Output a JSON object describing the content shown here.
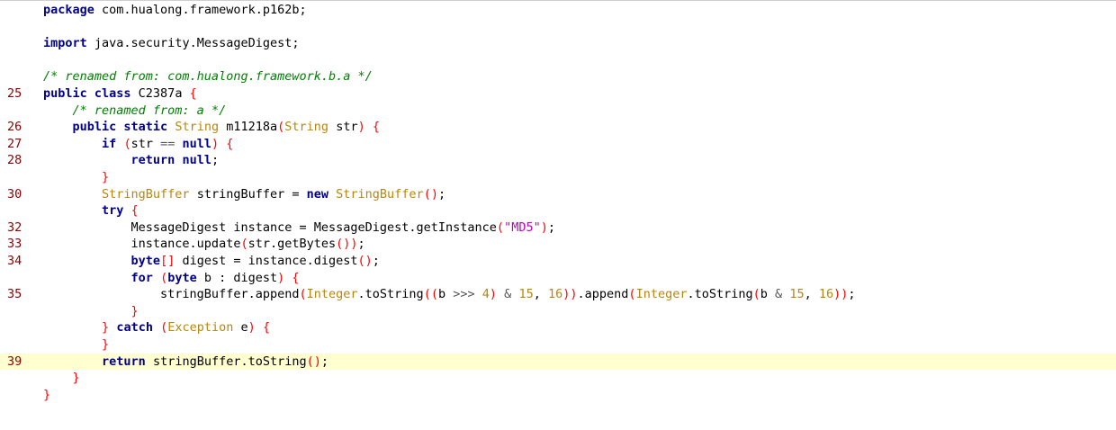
{
  "lines": [
    {
      "ln": "",
      "code": [
        [
          "kw",
          "package"
        ],
        [
          "pl",
          " com.hualong.framework.p162b;"
        ]
      ]
    },
    {
      "ln": "",
      "code": []
    },
    {
      "ln": "",
      "code": [
        [
          "kw",
          "import"
        ],
        [
          "pl",
          " java.security.MessageDigest;"
        ]
      ]
    },
    {
      "ln": "",
      "code": []
    },
    {
      "ln": "",
      "code": [
        [
          "cm",
          "/* renamed from: com.hualong.framework.b.a */"
        ]
      ]
    },
    {
      "ln": "25",
      "code": [
        [
          "kw",
          "public class"
        ],
        [
          "pl",
          " C2387a "
        ],
        [
          "br",
          "{"
        ]
      ]
    },
    {
      "ln": "",
      "code": [
        [
          "pl",
          "    "
        ],
        [
          "cm",
          "/* renamed from: a */"
        ]
      ]
    },
    {
      "ln": "26",
      "code": [
        [
          "pl",
          "    "
        ],
        [
          "kw",
          "public static"
        ],
        [
          "pl",
          " "
        ],
        [
          "ty",
          "String"
        ],
        [
          "pl",
          " m11218a"
        ],
        [
          "br",
          "("
        ],
        [
          "ty",
          "String"
        ],
        [
          "pl",
          " str"
        ],
        [
          "br",
          ")"
        ],
        [
          "pl",
          " "
        ],
        [
          "br",
          "{"
        ]
      ]
    },
    {
      "ln": "27",
      "code": [
        [
          "pl",
          "        "
        ],
        [
          "kw",
          "if"
        ],
        [
          "pl",
          " "
        ],
        [
          "br",
          "("
        ],
        [
          "pl",
          "str "
        ],
        [
          "op",
          "=="
        ],
        [
          "pl",
          " "
        ],
        [
          "kw",
          "null"
        ],
        [
          "br",
          ")"
        ],
        [
          "pl",
          " "
        ],
        [
          "br",
          "{"
        ]
      ]
    },
    {
      "ln": "28",
      "code": [
        [
          "pl",
          "            "
        ],
        [
          "kw",
          "return null"
        ],
        [
          "pl",
          ";"
        ]
      ]
    },
    {
      "ln": "",
      "code": [
        [
          "pl",
          "        "
        ],
        [
          "br",
          "}"
        ]
      ]
    },
    {
      "ln": "30",
      "code": [
        [
          "pl",
          "        "
        ],
        [
          "ty",
          "StringBuffer"
        ],
        [
          "pl",
          " stringBuffer = "
        ],
        [
          "kw",
          "new"
        ],
        [
          "pl",
          " "
        ],
        [
          "ty",
          "StringBuffer"
        ],
        [
          "br",
          "()"
        ],
        [
          "pl",
          ";"
        ]
      ]
    },
    {
      "ln": "",
      "code": [
        [
          "pl",
          "        "
        ],
        [
          "kw",
          "try"
        ],
        [
          "pl",
          " "
        ],
        [
          "br",
          "{"
        ]
      ]
    },
    {
      "ln": "32",
      "code": [
        [
          "pl",
          "            MessageDigest instance = MessageDigest.getInstance"
        ],
        [
          "br",
          "("
        ],
        [
          "st",
          "\"MD5\""
        ],
        [
          "br",
          ")"
        ],
        [
          "pl",
          ";"
        ]
      ]
    },
    {
      "ln": "33",
      "code": [
        [
          "pl",
          "            instance.update"
        ],
        [
          "br",
          "("
        ],
        [
          "pl",
          "str.getBytes"
        ],
        [
          "br",
          "())"
        ],
        [
          "pl",
          ";"
        ]
      ]
    },
    {
      "ln": "34",
      "code": [
        [
          "pl",
          "            "
        ],
        [
          "kw",
          "byte"
        ],
        [
          "br",
          "[]"
        ],
        [
          "pl",
          " digest = instance.digest"
        ],
        [
          "br",
          "()"
        ],
        [
          "pl",
          ";"
        ]
      ]
    },
    {
      "ln": "",
      "code": [
        [
          "pl",
          "            "
        ],
        [
          "kw",
          "for"
        ],
        [
          "pl",
          " "
        ],
        [
          "br",
          "("
        ],
        [
          "kw",
          "byte"
        ],
        [
          "pl",
          " b : digest"
        ],
        [
          "br",
          ")"
        ],
        [
          "pl",
          " "
        ],
        [
          "br",
          "{"
        ]
      ]
    },
    {
      "ln": "35",
      "code": [
        [
          "pl",
          "                stringBuffer.append"
        ],
        [
          "br",
          "("
        ],
        [
          "ty",
          "Integer"
        ],
        [
          "pl",
          ".toString"
        ],
        [
          "br",
          "(("
        ],
        [
          "pl",
          "b "
        ],
        [
          "op",
          ">>>"
        ],
        [
          "pl",
          " "
        ],
        [
          "nm",
          "4"
        ],
        [
          "br",
          ")"
        ],
        [
          "pl",
          " "
        ],
        [
          "op",
          "&"
        ],
        [
          "pl",
          " "
        ],
        [
          "nm",
          "15"
        ],
        [
          "pl",
          ", "
        ],
        [
          "nm",
          "16"
        ],
        [
          "br",
          "))"
        ],
        [
          "pl",
          ".append"
        ],
        [
          "br",
          "("
        ],
        [
          "ty",
          "Integer"
        ],
        [
          "pl",
          ".toString"
        ],
        [
          "br",
          "("
        ],
        [
          "pl",
          "b "
        ],
        [
          "op",
          "&"
        ],
        [
          "pl",
          " "
        ],
        [
          "nm",
          "15"
        ],
        [
          "pl",
          ", "
        ],
        [
          "nm",
          "16"
        ],
        [
          "br",
          "))"
        ],
        [
          "pl",
          ";"
        ]
      ]
    },
    {
      "ln": "",
      "code": [
        [
          "pl",
          "            "
        ],
        [
          "br",
          "}"
        ]
      ]
    },
    {
      "ln": "",
      "code": [
        [
          "pl",
          "        "
        ],
        [
          "br",
          "}"
        ],
        [
          "pl",
          " "
        ],
        [
          "kw",
          "catch"
        ],
        [
          "pl",
          " "
        ],
        [
          "br",
          "("
        ],
        [
          "ty",
          "Exception"
        ],
        [
          "pl",
          " e"
        ],
        [
          "br",
          ")"
        ],
        [
          "pl",
          " "
        ],
        [
          "br",
          "{"
        ]
      ]
    },
    {
      "ln": "",
      "code": [
        [
          "pl",
          "        "
        ],
        [
          "br",
          "}"
        ]
      ]
    },
    {
      "ln": "39",
      "hl": true,
      "code": [
        [
          "pl",
          "        "
        ],
        [
          "kw",
          "return"
        ],
        [
          "pl",
          " stringBuffer.toString"
        ],
        [
          "br",
          "()"
        ],
        [
          "pl",
          ";"
        ]
      ]
    },
    {
      "ln": "",
      "code": [
        [
          "pl",
          "    "
        ],
        [
          "br",
          "}"
        ]
      ]
    },
    {
      "ln": "",
      "code": [
        [
          "br",
          "}"
        ]
      ]
    }
  ]
}
